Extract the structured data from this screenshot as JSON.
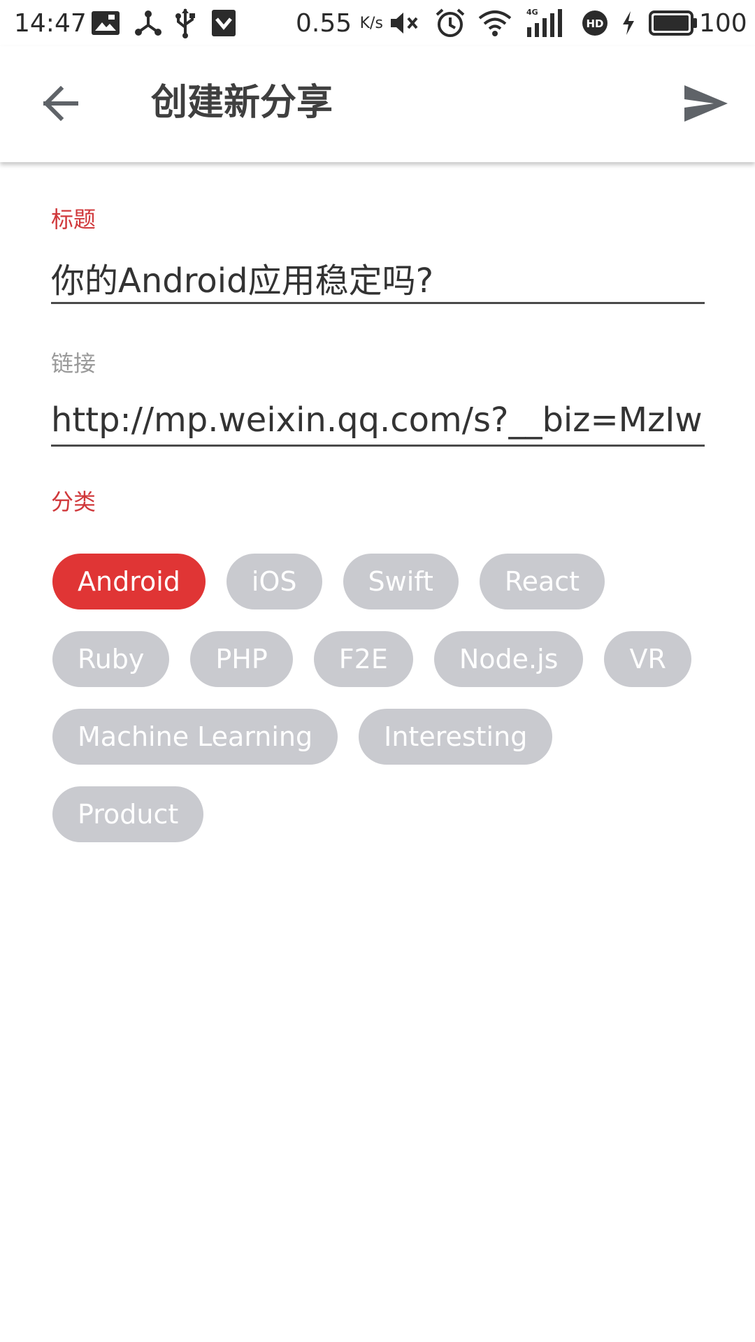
{
  "status_bar": {
    "time": "14:47",
    "net_speed": "0.55",
    "net_speed_unit": "K/s",
    "signal_type": "4G",
    "hd_badge": "HD",
    "battery_level": "100"
  },
  "app_bar": {
    "title": "创建新分享",
    "back_icon": "arrow-back-icon",
    "send_icon": "send-icon"
  },
  "form": {
    "title_label": "标题",
    "title_value": "你的Android应用稳定吗?",
    "link_label": "链接",
    "link_value": "http://mp.weixin.qq.com/s?__biz=MzIw",
    "category_label": "分类"
  },
  "categories": [
    {
      "label": "Android",
      "selected": true
    },
    {
      "label": "iOS",
      "selected": false
    },
    {
      "label": "Swift",
      "selected": false
    },
    {
      "label": "React",
      "selected": false
    },
    {
      "label": "Ruby",
      "selected": false
    },
    {
      "label": "PHP",
      "selected": false
    },
    {
      "label": "F2E",
      "selected": false
    },
    {
      "label": "Node.js",
      "selected": false
    },
    {
      "label": "VR",
      "selected": false
    },
    {
      "label": "Machine Learning",
      "selected": false
    },
    {
      "label": "Interesting",
      "selected": false
    },
    {
      "label": "Product",
      "selected": false
    }
  ],
  "colors": {
    "accent": "#e03535",
    "label_active": "#d0383b",
    "label_inactive": "#9a9a9a",
    "chip_unselected": "#c9cacf",
    "icon": "#5f6368"
  }
}
